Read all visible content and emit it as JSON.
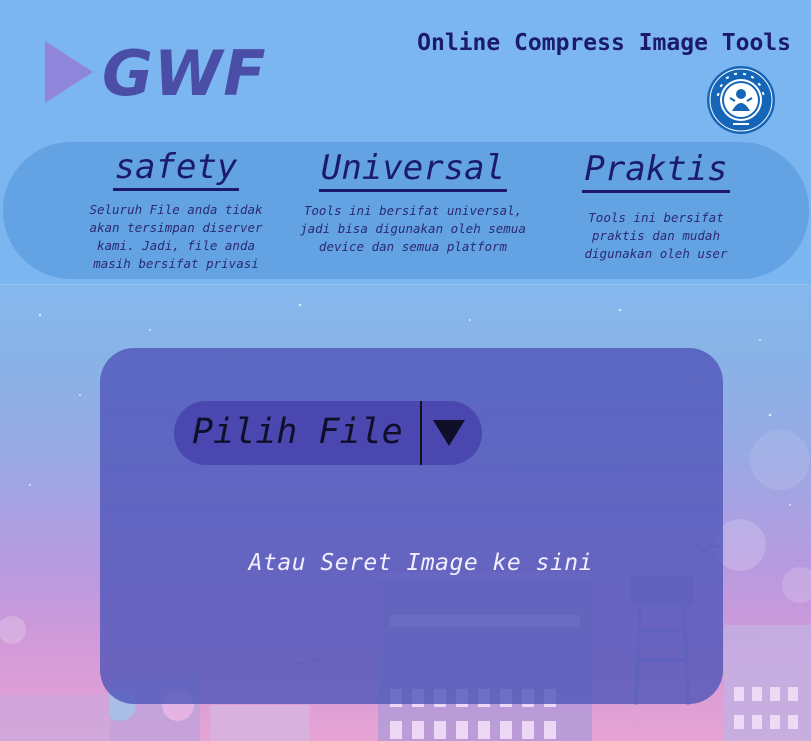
{
  "brand": {
    "logo_text": "GWF",
    "site_title": "Online Compress Image Tools"
  },
  "features": [
    {
      "title": "safety",
      "description": "Seluruh File anda tidak akan tersimpan diserver kami. Jadi, file anda masih bersifat privasi"
    },
    {
      "title": "Universal",
      "description": "Tools ini bersifat universal, jadi bisa digunakan oleh semua device dan semua platform"
    },
    {
      "title": "Praktis",
      "description": "Tools ini bersifat praktis dan mudah digunakan oleh user"
    }
  ],
  "upload": {
    "select_label": "Pilih File",
    "drop_hint": "Atau Seret Image ke sini"
  },
  "colors": {
    "header_bg": "#7cb6f1",
    "features_bar": "#63a3e3",
    "heading": "#1b1a6e",
    "panel": "#5258ba",
    "select_button": "#4b47b0"
  },
  "icons": {
    "logo": "play-triangle-icon",
    "seal": "university-seal-icon",
    "dropdown": "triangle-down-icon"
  }
}
